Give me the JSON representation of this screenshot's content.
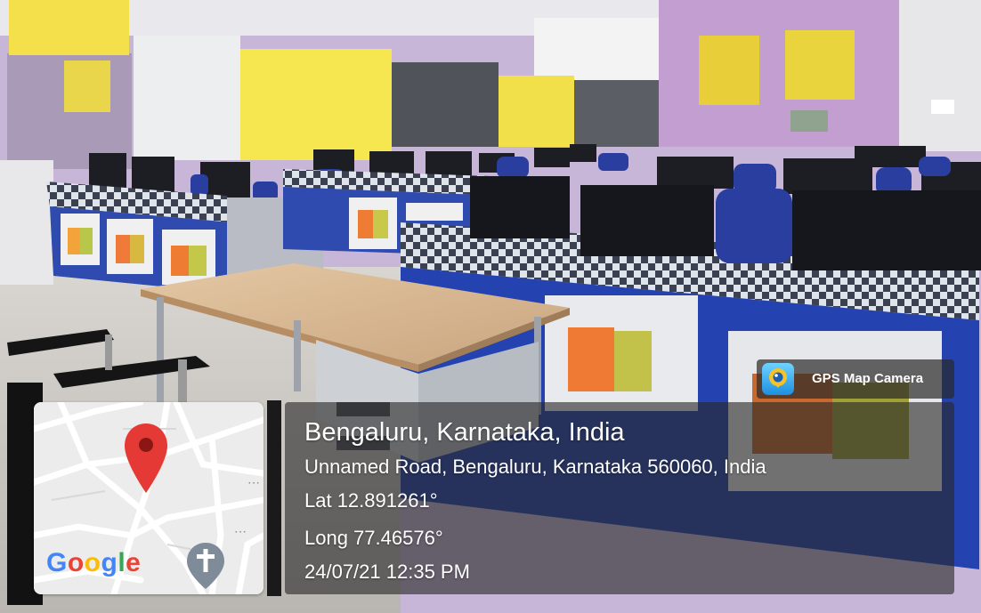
{
  "photo": {
    "scene": "computer-lab-photo"
  },
  "map": {
    "brand_letters": [
      {
        "ch": "G",
        "color": "#4285F4"
      },
      {
        "ch": "o",
        "color": "#EA4335"
      },
      {
        "ch": "o",
        "color": "#FBBC05"
      },
      {
        "ch": "g",
        "color": "#4285F4"
      },
      {
        "ch": "l",
        "color": "#34A853"
      },
      {
        "ch": "e",
        "color": "#EA4335"
      }
    ],
    "pin_icon": "location-pin-icon",
    "pin_color": "#E53935",
    "poi_icon": "church-cross-icon"
  },
  "camera_badge": {
    "label": "GPS Map Camera",
    "icon": "camera-lens-icon"
  },
  "location": {
    "place": "Bengaluru, Karnataka, India",
    "address": "Unnamed Road, Bengaluru, Karnataka 560060, India",
    "latitude": "Lat 12.891261°",
    "longitude": "Long 77.46576°",
    "datetime": "24/07/21 12:35 PM"
  }
}
